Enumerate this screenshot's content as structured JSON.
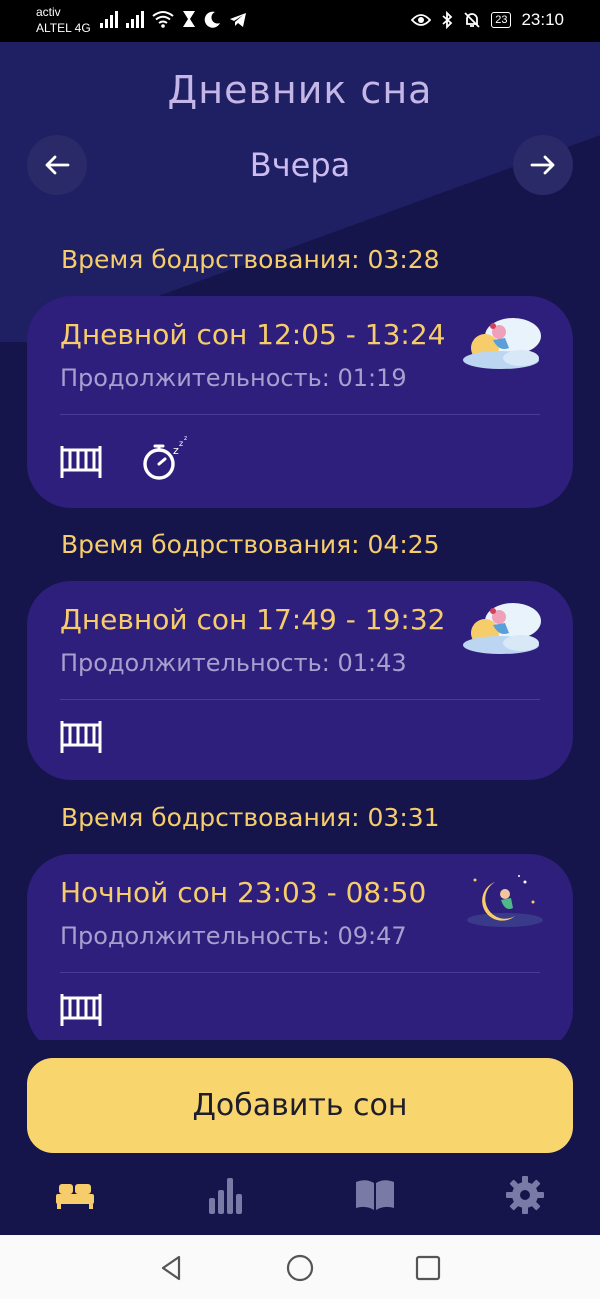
{
  "status": {
    "carrier_top": "activ",
    "carrier_bottom": "ALTEL 4G",
    "battery": "23",
    "time": "23:10"
  },
  "header": {
    "title": "Дневник сна",
    "date": "Вчера",
    "prev_icon": "arrow-left-icon",
    "next_icon": "arrow-right-icon"
  },
  "entries": [
    {
      "awake_text": "Время бодрствования: 03:28",
      "title": "Дневной сон 12:05 - 13:24",
      "duration": "Продолжительность: 01:19",
      "art": "day-sleep-illustration",
      "icons": [
        "crib-icon",
        "stopwatch-sleep-icon"
      ]
    },
    {
      "awake_text": "Время бодрствования: 04:25",
      "title": "Дневной сон 17:49 - 19:32",
      "duration": "Продолжительность: 01:43",
      "art": "day-sleep-illustration",
      "icons": [
        "crib-icon"
      ]
    },
    {
      "awake_text": "Время бодрствования: 03:31",
      "title": "Ночной сон 23:03 - 08:50",
      "duration": "Продолжительность: 09:47",
      "art": "night-sleep-illustration",
      "icons": [
        "crib-icon"
      ]
    }
  ],
  "add_button": "Добавить сон",
  "tabs": [
    "bed-icon",
    "stats-icon",
    "book-icon",
    "gear-icon"
  ],
  "colors": {
    "background": "#15154c",
    "card": "#2e1f7d",
    "accent": "#f6cd6a",
    "button": "#f9d56e"
  }
}
